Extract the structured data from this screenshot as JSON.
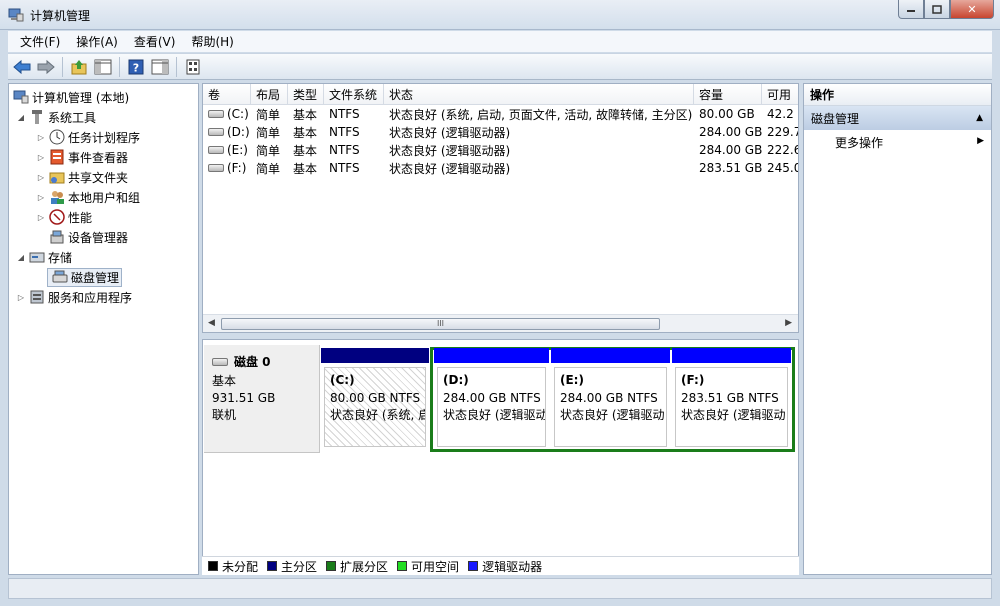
{
  "window": {
    "title": "计算机管理",
    "minimize": "▭",
    "maximize": "□",
    "close": "✕"
  },
  "menu": [
    "文件(F)",
    "操作(A)",
    "查看(V)",
    "帮助(H)"
  ],
  "toolbar": {
    "icons": [
      "back-arrow-icon",
      "forward-arrow-icon",
      "up-folder-icon",
      "show-hide-tree-icon",
      "help-icon",
      "show-hide-action-icon",
      "properties-icon"
    ]
  },
  "tree": {
    "root": "计算机管理 (本地)",
    "system_tools": "系统工具",
    "task_scheduler": "任务计划程序",
    "event_viewer": "事件查看器",
    "shared_folders": "共享文件夹",
    "local_users": "本地用户和组",
    "performance": "性能",
    "device_manager": "设备管理器",
    "storage": "存储",
    "disk_management": "磁盘管理",
    "services_apps": "服务和应用程序"
  },
  "volumes": {
    "columns": [
      "卷",
      "布局",
      "类型",
      "文件系统",
      "状态",
      "容量",
      "可用"
    ],
    "rows": [
      [
        "(C:)",
        "简单",
        "基本",
        "NTFS",
        "状态良好 (系统, 启动, 页面文件, 活动, 故障转储, 主分区)",
        "80.00 GB",
        "42.2"
      ],
      [
        "(D:)",
        "简单",
        "基本",
        "NTFS",
        "状态良好 (逻辑驱动器)",
        "284.00 GB",
        "229.7"
      ],
      [
        "(E:)",
        "简单",
        "基本",
        "NTFS",
        "状态良好 (逻辑驱动器)",
        "284.00 GB",
        "222.6"
      ],
      [
        "(F:)",
        "简单",
        "基本",
        "NTFS",
        "状态良好 (逻辑驱动器)",
        "283.51 GB",
        "245.0"
      ]
    ],
    "scroll_thumb": "III"
  },
  "disk": {
    "name": "磁盘 0",
    "type": "基本",
    "size": "931.51 GB",
    "status": "联机",
    "partitions": [
      {
        "label": "(C:)",
        "size": "80.00 GB NTFS",
        "status": "状态良好 (系统, 启"
      },
      {
        "label": "(D:)",
        "size": "284.00 GB NTFS",
        "status": "状态良好 (逻辑驱动"
      },
      {
        "label": "(E:)",
        "size": "284.00 GB NTFS",
        "status": "状态良好 (逻辑驱动"
      },
      {
        "label": "(F:)",
        "size": "283.51 GB NTFS",
        "status": "状态良好 (逻辑驱动"
      }
    ]
  },
  "legend": [
    {
      "label": "未分配",
      "color": "#000000"
    },
    {
      "label": "主分区",
      "color": "#000080"
    },
    {
      "label": "扩展分区",
      "color": "#1a7d1a"
    },
    {
      "label": "可用空间",
      "color": "#22dd22"
    },
    {
      "label": "逻辑驱动器",
      "color": "#1a1aff"
    }
  ],
  "actions": {
    "header": "操作",
    "section": "磁盘管理",
    "more": "更多操作"
  },
  "colors": {
    "primary_bar": "#000080",
    "logical_bar": "#0000ff",
    "extended_frame": "#1a7d1a"
  }
}
